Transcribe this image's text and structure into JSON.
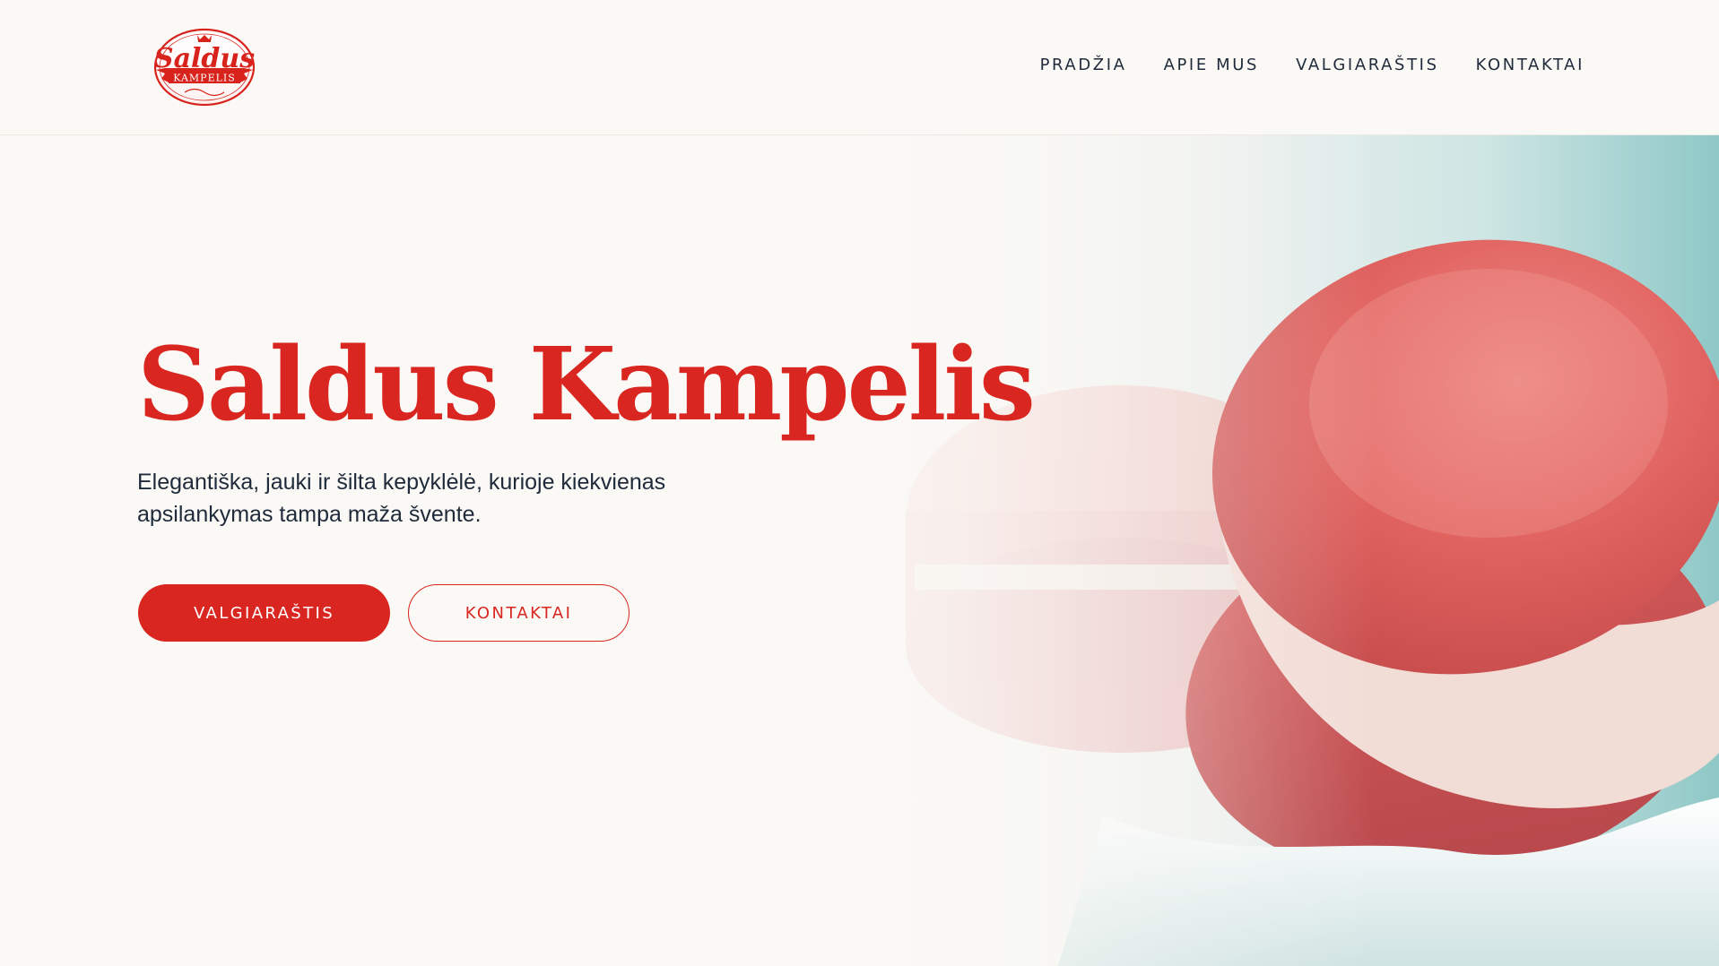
{
  "brand": {
    "logo_name": "Saldus",
    "logo_sub": "KAMPELIS",
    "accent_color": "#da2620",
    "text_color": "#1f2a3a"
  },
  "nav": {
    "items": [
      {
        "label": "PRADŽIA"
      },
      {
        "label": "APIE MUS"
      },
      {
        "label": "VALGIARAŠTIS"
      },
      {
        "label": "KONTAKTAI"
      }
    ]
  },
  "hero": {
    "title": "Saldus Kampelis",
    "subtitle": "Elegantiška, jauki ir šilta kepyklėlė, kurioje kiekvienas apsilankymas tampa maža švente.",
    "primary_button": "VALGIARAŠTIS",
    "secondary_button": "KONTAKTAI",
    "image": "pink-macarons"
  }
}
